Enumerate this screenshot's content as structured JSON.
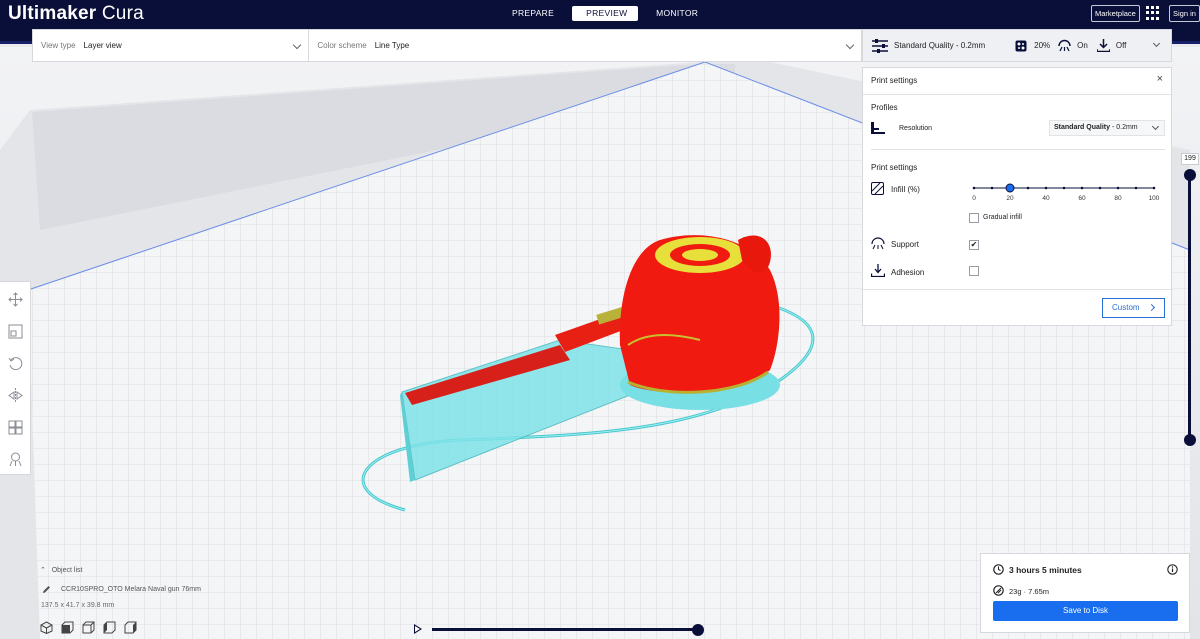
{
  "app": {
    "title_bold": "Ultimaker",
    "title_light": "Cura"
  },
  "stages": [
    {
      "label": "PREPARE",
      "active": false
    },
    {
      "label": "PREVIEW",
      "active": true
    },
    {
      "label": "MONITOR",
      "active": false
    }
  ],
  "header": {
    "marketplace_label": "Marketplace",
    "signin_label": "Sign in"
  },
  "toolbar": {
    "view_type_label": "View type",
    "view_type_value": "Layer view",
    "color_scheme_label": "Color scheme",
    "color_scheme_value": "Line Type"
  },
  "quality_bar": {
    "quality_label": "Standard Quality - 0.2mm",
    "infill_value": "20%",
    "support_value": "On",
    "adhesion_value": "Off"
  },
  "print_settings": {
    "title": "Print settings",
    "profiles_heading": "Profiles",
    "resolution_label": "Resolution",
    "resolution_value_bold": "Standard Quality",
    "resolution_value_rest": " - 0.2mm",
    "settings_heading": "Print settings",
    "infill_label": "Infill (%)",
    "infill_percent": 20,
    "infill_ticks": [
      "0",
      "20",
      "40",
      "60",
      "80",
      "100"
    ],
    "gradual_infill_label": "Gradual infill",
    "gradual_infill_checked": false,
    "support_label": "Support",
    "support_checked": true,
    "adhesion_label": "Adhesion",
    "adhesion_checked": false,
    "custom_label": "Custom"
  },
  "layer_slider": {
    "current_layer": "199",
    "min_fraction": 0.0,
    "max_fraction": 1.0
  },
  "sim_slider": {
    "progress_fraction": 1.0
  },
  "object_list": {
    "label": "Object list",
    "object_name": "CCR10SPRO_OTO Melara Naval gun 76mm",
    "dimensions": "137.5 x 41.7 x 39.8 mm"
  },
  "job": {
    "time": "3 hours 5 minutes",
    "material": "23g · 7.65m",
    "save_label": "Save to Disk"
  },
  "colors": {
    "brand": "#0a0f3a",
    "accent": "#196ef0",
    "model_wall": "#ff1a0a",
    "support": "#6ee6ee",
    "infill": "#e8e030"
  },
  "icons": [
    "move-icon",
    "scale-icon",
    "rotate-icon",
    "mirror-icon",
    "per-model-settings-icon",
    "support-blocker-icon",
    "settings-sliders-icon",
    "infill-icon",
    "support-icon",
    "adhesion-icon",
    "clock-icon",
    "info-icon",
    "filament-icon",
    "pencil-icon",
    "chevron-up-icon"
  ]
}
